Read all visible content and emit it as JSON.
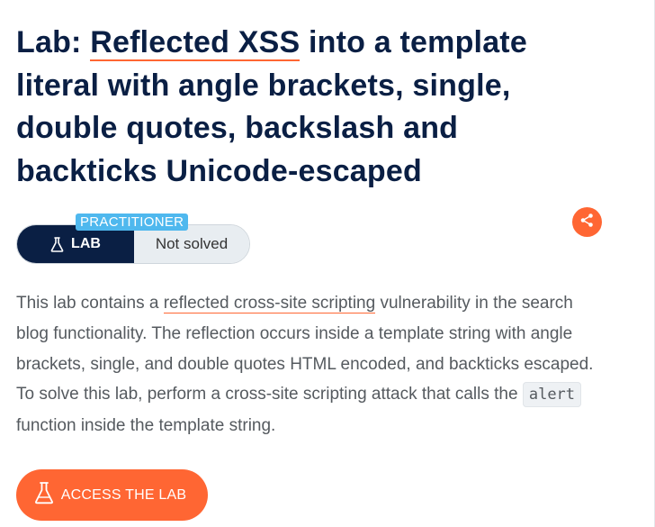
{
  "title": {
    "prefix": "Lab: ",
    "link": "Reflected XSS",
    "rest": " into a template literal with angle brackets, single, double quotes, backslash and backticks Unicode-escaped"
  },
  "status": {
    "level": "PRACTITIONER",
    "lab_label": "LAB",
    "state": "Not solved"
  },
  "share": {
    "icon": "share-icon"
  },
  "description": {
    "part1": "This lab contains a ",
    "link": "reflected cross-site scripting",
    "part2": " vulnerability in the search blog functionality. The reflection occurs inside a template string with angle brackets, single, and double quotes HTML encoded, and backticks escaped. To solve this lab, perform a cross-site scripting attack that calls the ",
    "code": "alert",
    "part3": " function inside the template string."
  },
  "access_button": {
    "label": "ACCESS THE LAB",
    "icon": "flask-icon"
  },
  "colors": {
    "accent": "#ff6633",
    "navy": "#0a1f44",
    "level_badge": "#4fb8ee",
    "status_bg": "#e8edf1"
  }
}
